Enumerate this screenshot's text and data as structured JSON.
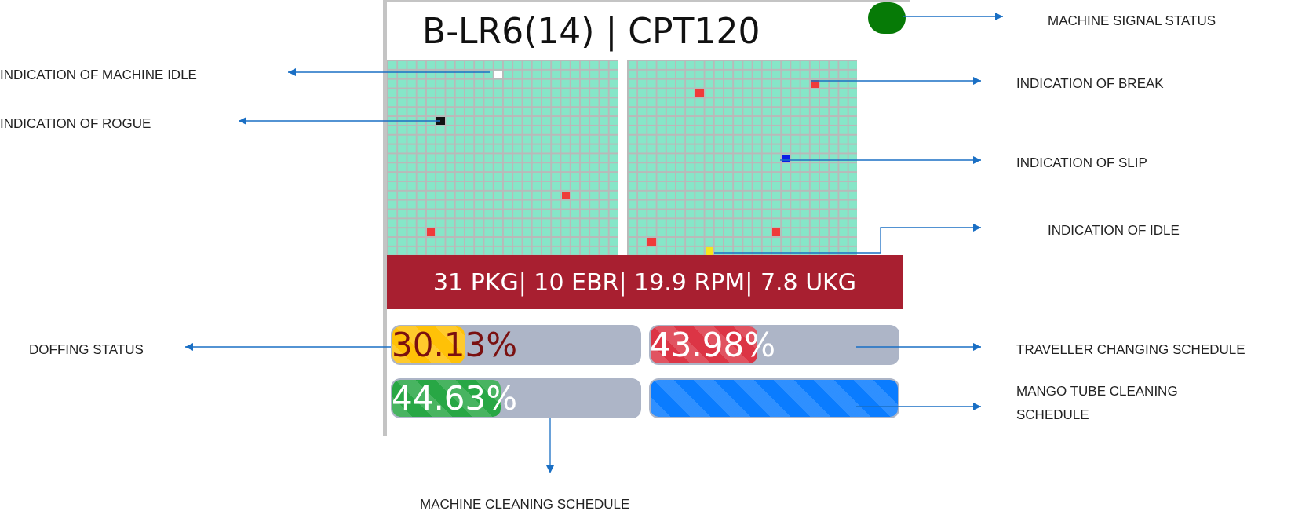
{
  "machine": {
    "title": "B-LR6(14) | CPT120",
    "signal": {
      "color": "#067a06"
    },
    "grids": [
      {
        "markers": [
          {
            "color": "#ffffff"
          },
          {
            "color": "#111111"
          },
          {
            "color": "#f03a3a"
          },
          {
            "color": "#f03a3a"
          }
        ]
      },
      {
        "markers": [
          {
            "color": "#f03a3a"
          },
          {
            "color": "#f03a3a"
          },
          {
            "color": "#0a1ee6"
          },
          {
            "color": "#f03a3a"
          },
          {
            "color": "#f03a3a"
          },
          {
            "color": "#f5e61e"
          }
        ]
      }
    ],
    "stats": "31 PKG| 10 EBR| 19.9 RPM| 7.8 UKG",
    "bars": [
      {
        "value": "30.13%",
        "level": 0.3013,
        "color": "#ffc107"
      },
      {
        "value": "43.98%",
        "level": 0.4398,
        "color": "#dc3545"
      },
      {
        "value": "44.63%",
        "level": 0.4463,
        "color": "#28a745"
      },
      {
        "level": 1,
        "color": "#0a7cff"
      }
    ]
  },
  "annotations": [
    "MACHINE SIGNAL STATUS",
    "INDICATION OF MACHINE IDLE",
    "INDICATION OF BREAK",
    "INDICATION OF ROGUE",
    "INDICATION OF SLIP",
    "INDICATION OF IDLE",
    "DOFFING STATUS",
    "TRAVELLER CHANGING SCHEDULE",
    "MANGO TUBE CLEANING SCHEDULE",
    "MACHINE CLEANING SCHEDULE"
  ]
}
